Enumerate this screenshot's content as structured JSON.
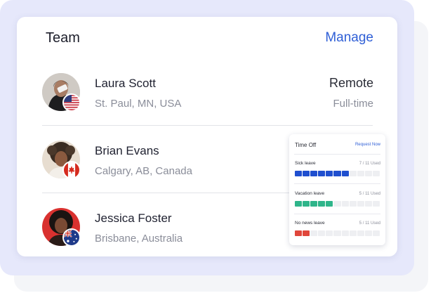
{
  "card": {
    "title": "Team",
    "manage_label": "Manage"
  },
  "members": [
    {
      "name": "Laura Scott",
      "location": "St. Paul, MN, USA",
      "work_type": "Remote",
      "employment_type": "Full-time",
      "flag": "us-flag-icon"
    },
    {
      "name": "Brian Evans",
      "location": "Calgary, AB, Canada",
      "flag": "canada-flag-icon"
    },
    {
      "name": "Jessica Foster",
      "location": "Brisbane, Australia",
      "flag": "australia-flag-icon"
    }
  ],
  "time_off": {
    "title": "Time Off",
    "request_label": "Request Now",
    "categories": [
      {
        "label": "Sick leave",
        "used_text": "7 / 11 Used",
        "used": 7,
        "total": 11,
        "color": "#1f4fcf"
      },
      {
        "label": "Vacation leave",
        "used_text": "5 / 11 Used",
        "used": 5,
        "total": 11,
        "color": "#2fb58a"
      },
      {
        "label": "No news leave",
        "used_text": "5 / 11 Used",
        "used": 2,
        "total": 11,
        "color": "#e0463b"
      }
    ]
  },
  "colors": {
    "accent": "#2f5fd6",
    "background": "#e6e8fb"
  }
}
